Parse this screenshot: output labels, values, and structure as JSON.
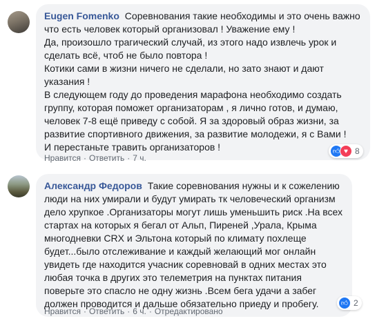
{
  "comments": [
    {
      "author": "Eugen Fomenko",
      "text": "Соревнования такие необходимы и это очень важно что есть человек который организовал ! Уважение ему !\nДа, произошло трагический случай, из этого надо извлечь урок и сделать всё, чтоб не было повтора !\nКотики сами в жизни ничего не сделали, но зато знают и дают указания !\nВ следующем году до проведения марафона необходимо создать группу, которая поможет организаторам , я лично готов, и думаю, человек 7-8 ещё приведу с собой. Я за здоровый образ жизни, за развитие спортивного движения, за развитие молодежи, я с Вами !\nИ перестаньте травить организаторов !",
      "like_label": "Нравится",
      "reply_label": "Ответить",
      "time": "7 ч.",
      "reaction_count": "8",
      "reaction_icons": [
        "like-icon",
        "love-icon"
      ],
      "like_color": "#2078f4",
      "love_color": "#f33e58"
    },
    {
      "author": "Александр Федоров",
      "text": "Такие соревнования нужны и к сожелению люди на них умирали и будут умирать тк человеческий организм дело хрупкое .Организаторы могут лишь уменьшить риск .На всех стартах на которых я бегал от Альп, Пиреней ,Урала, Крыма многодневки CRX и Эльтона который по климату похлеще будет...было отслеживание и каждый желающий мог онлайн увидеть где находится учасник соревновай в одних местах это любая точка в других это телеметрия на пунктах питания поверьте это спасло не одну жизнь .Всем бега удачи а забег должен проводится и дальше обязательно приеду и пробегу.",
      "like_label": "Нравится",
      "reply_label": "Ответить",
      "time": "6 ч.",
      "edited_label": "Отредактировано",
      "reaction_count": "2",
      "reaction_icons": [
        "like-icon"
      ],
      "like_color": "#2078f4"
    }
  ],
  "colors": {
    "author": "#385898",
    "bubble": "#f2f3f5",
    "meta": "#606770"
  }
}
